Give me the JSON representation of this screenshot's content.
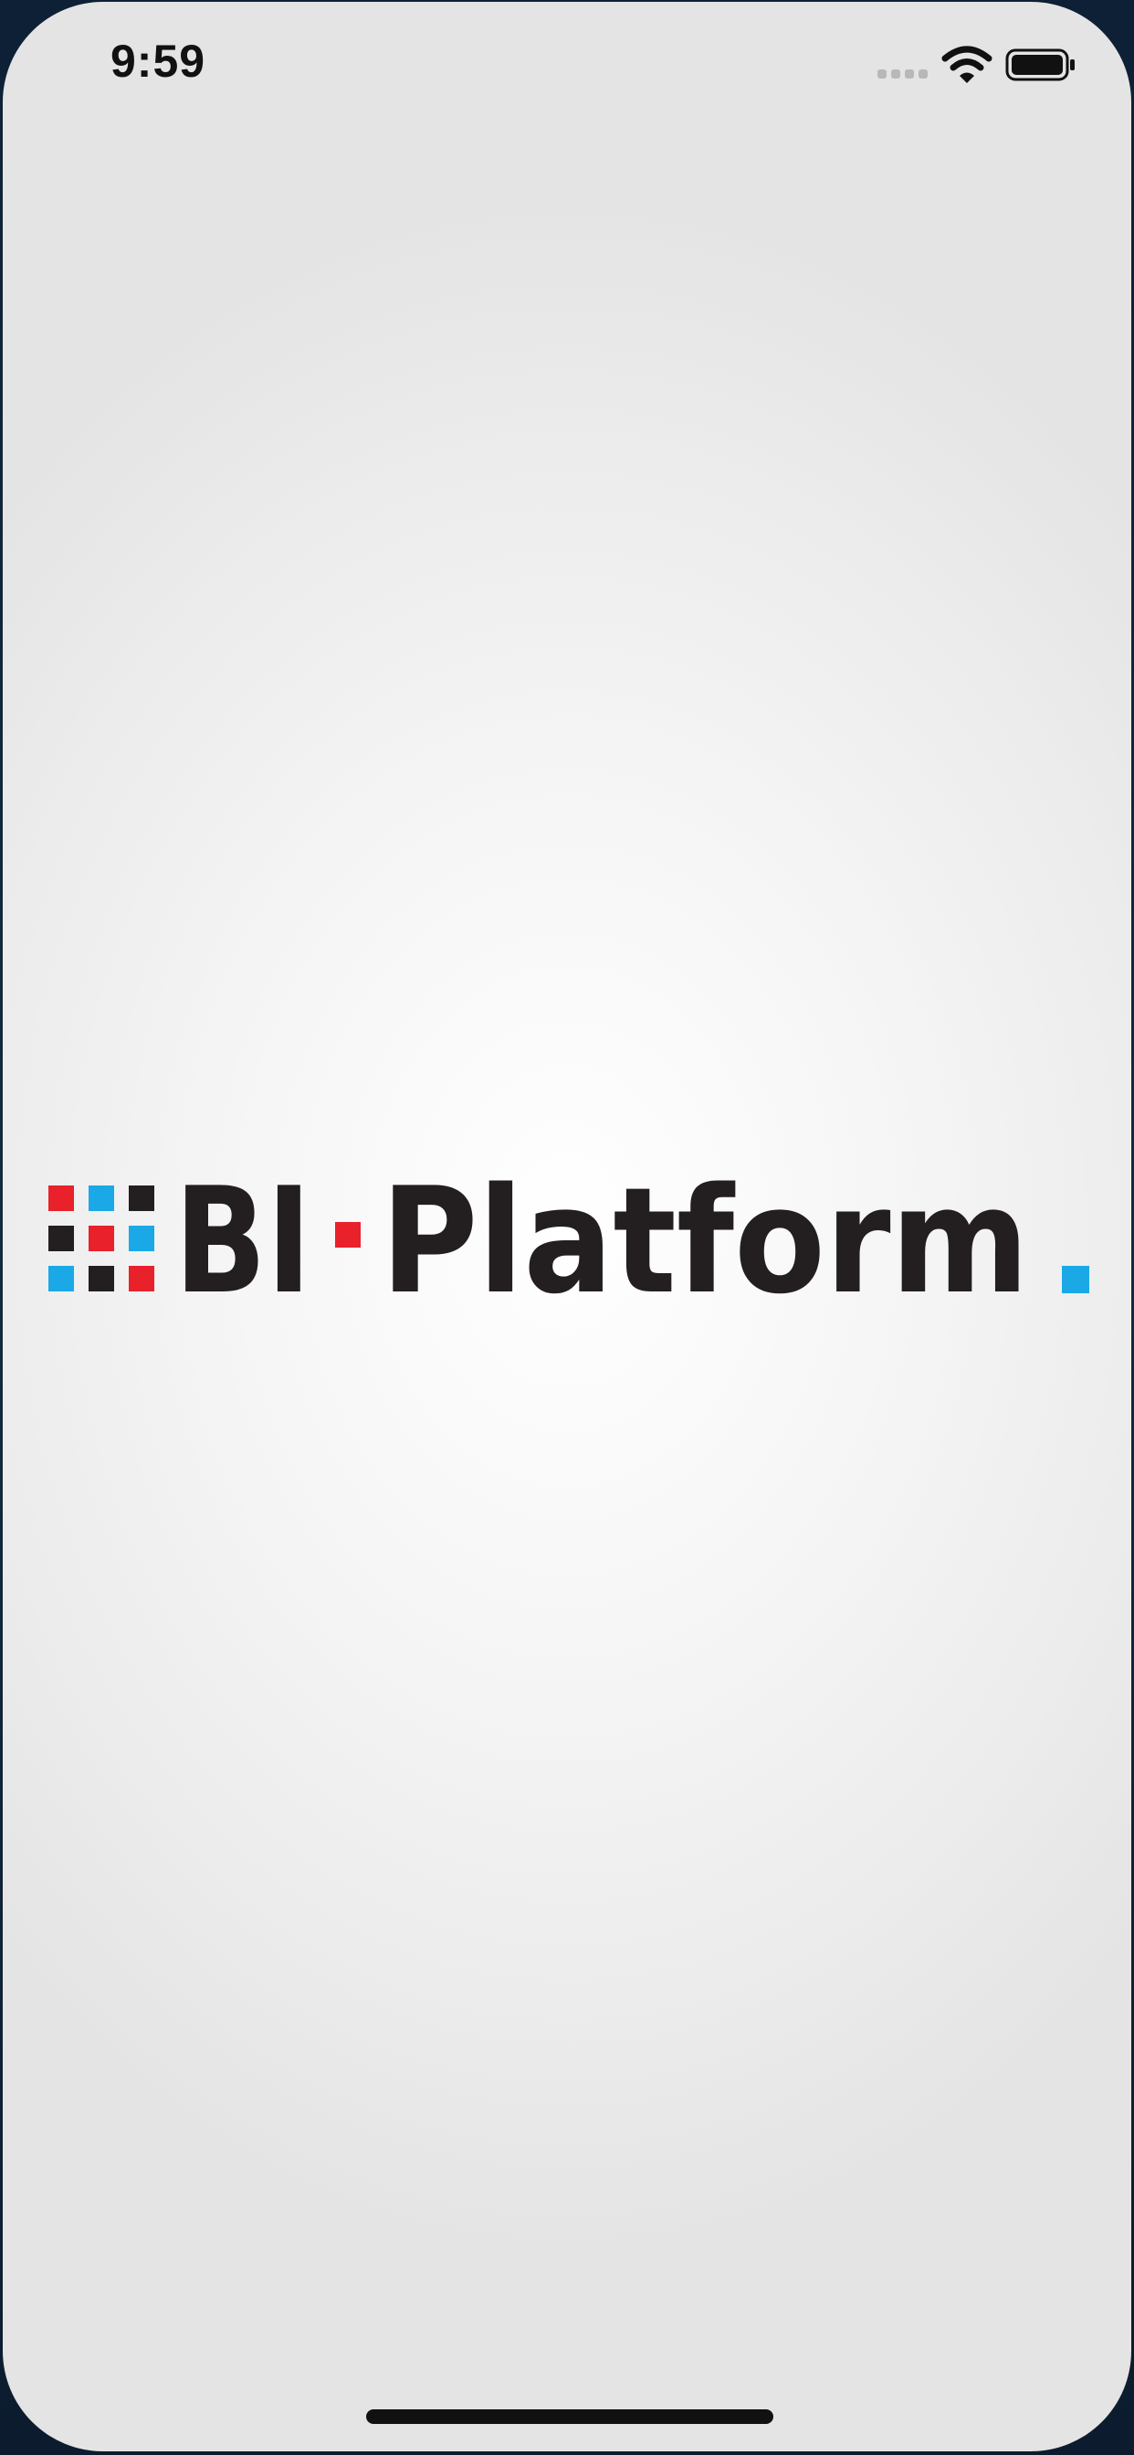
{
  "status_bar": {
    "time": "9:59",
    "icons": [
      "cellular-signal-icon",
      "wifi-icon",
      "battery-icon"
    ]
  },
  "splash": {
    "logo_text": "BI·Platform.",
    "brand_colors": {
      "red": "#e8212b",
      "blue": "#1aa9e6",
      "dark": "#231f20"
    }
  }
}
